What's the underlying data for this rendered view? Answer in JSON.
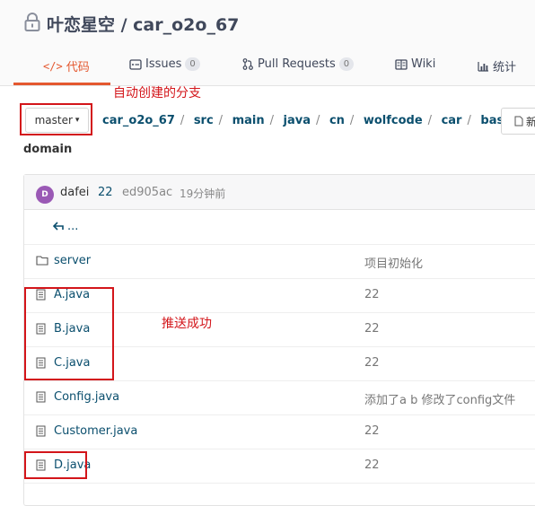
{
  "repo": {
    "title": "叶恋星空 / car_o2o_67"
  },
  "tabs": [
    {
      "label": "代码",
      "icon": "code-icon",
      "active": true
    },
    {
      "label": "Issues",
      "icon": "issues-icon",
      "count": "0"
    },
    {
      "label": "Pull Requests",
      "icon": "pull-request-icon",
      "count": "0"
    },
    {
      "label": "Wiki",
      "icon": "wiki-icon"
    },
    {
      "label": "统计",
      "icon": "stats-icon"
    }
  ],
  "branch": {
    "label": "master",
    "caret": "▾"
  },
  "annotations": {
    "branch_note": "自动创建的分支",
    "push_note": "推送成功"
  },
  "breadcrumb": {
    "parts": [
      "car_o2o_67",
      "src",
      "main",
      "java",
      "cn",
      "wolfcode",
      "car",
      "base"
    ],
    "separator": "/",
    "last": "domain"
  },
  "new_button": {
    "label": "新"
  },
  "commit": {
    "avatar_letter": "D",
    "author": "dafei",
    "message": "22",
    "sha": "ed905ac",
    "time": "19分钟前"
  },
  "back_link": {
    "label": "..."
  },
  "files": [
    {
      "name": "server",
      "type": "folder",
      "message": "项目初始化"
    },
    {
      "name": "A.java",
      "type": "file",
      "message": "22"
    },
    {
      "name": "B.java",
      "type": "file",
      "message": "22"
    },
    {
      "name": "C.java",
      "type": "file",
      "message": "22"
    },
    {
      "name": "Config.java",
      "type": "file",
      "message": "添加了a b 修改了config文件"
    },
    {
      "name": "Customer.java",
      "type": "file",
      "message": "22"
    },
    {
      "name": "D.java",
      "type": "file",
      "message": "22"
    }
  ],
  "colors": {
    "accent": "#e4582f",
    "link": "#0b4f6e",
    "annotation": "#d3151a",
    "avatar": "#9a59b5"
  }
}
